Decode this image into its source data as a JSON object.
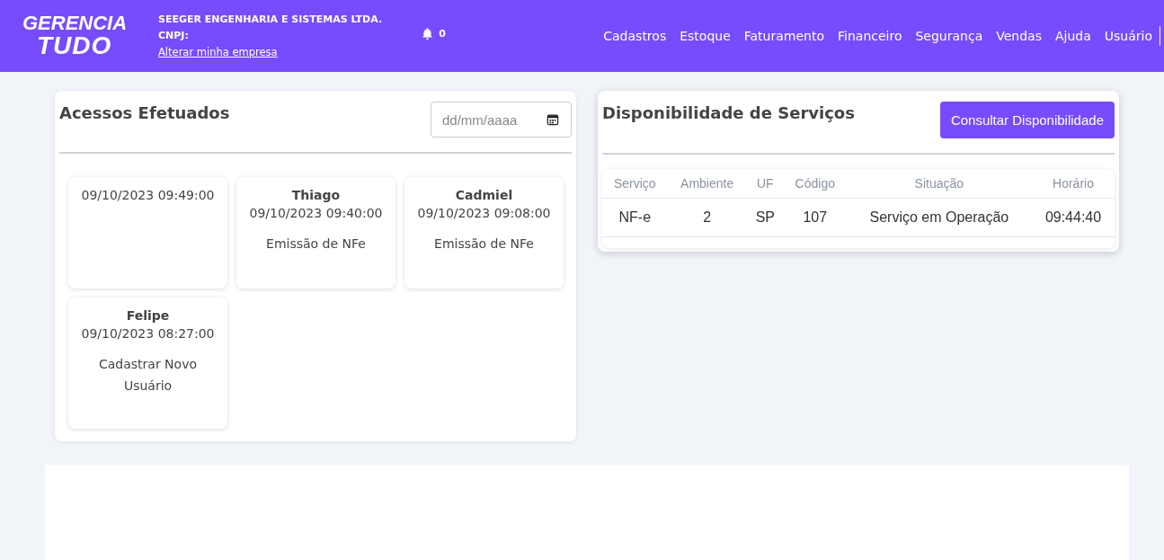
{
  "header": {
    "logo": {
      "line1": "GERENCIA",
      "line2": "TUDO"
    },
    "company": "SEEGER ENGENHARIA E SISTEMAS LTDA.",
    "cnpj_label": "CNPJ:",
    "change_link": "Alterar minha empresa",
    "notifications": "0",
    "menu": [
      "Cadastros",
      "Estoque",
      "Faturamento",
      "Financeiro",
      "Segurança",
      "Vendas",
      "Ajuda",
      "Usuário"
    ]
  },
  "accesses": {
    "title": "Acessos Efetuados",
    "date_placeholder": "dd/mm/aaaa",
    "items": [
      {
        "datetime": "09/10/2023 09:49:00"
      },
      {
        "user": "Thiago",
        "datetime": "09/10/2023 09:40:00",
        "action": "Emissão de NFe"
      },
      {
        "user": "Cadmiel",
        "datetime": "09/10/2023 09:08:00",
        "action": "Emissão de NFe"
      },
      {
        "user": "Felipe",
        "datetime": "09/10/2023 08:27:00",
        "action": "Cadastrar Novo Usuário"
      }
    ]
  },
  "services": {
    "title": "Disponibilidade de Serviços",
    "button": "Consultar Disponibilidade",
    "table": {
      "columns": [
        "Serviço",
        "Ambiente",
        "UF",
        "Código",
        "Situação",
        "Horário"
      ],
      "rows": [
        [
          "NF-e",
          "2",
          "SP",
          "107",
          "Serviço em Operação",
          "09:44:40"
        ]
      ]
    }
  }
}
